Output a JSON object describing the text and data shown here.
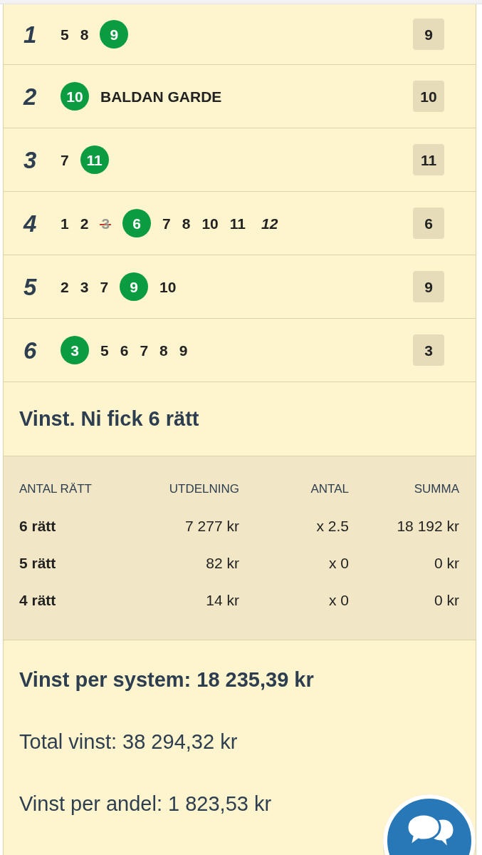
{
  "races": [
    {
      "number": "1",
      "picks": [
        {
          "text": "5",
          "kind": "plain"
        },
        {
          "text": "8",
          "kind": "plain"
        },
        {
          "text": "9",
          "kind": "winner"
        }
      ],
      "winner": "9"
    },
    {
      "number": "2",
      "picks": [
        {
          "text": "10",
          "kind": "winner"
        }
      ],
      "horse_name": "BALDAN GARDE",
      "winner": "10"
    },
    {
      "number": "3",
      "picks": [
        {
          "text": "7",
          "kind": "plain"
        },
        {
          "text": "11",
          "kind": "winner"
        }
      ],
      "winner": "11"
    },
    {
      "number": "4",
      "picks": [
        {
          "text": "1",
          "kind": "plain"
        },
        {
          "text": "2",
          "kind": "plain"
        },
        {
          "text": "3",
          "kind": "scratched"
        },
        {
          "text": "6",
          "kind": "winner"
        },
        {
          "text": "7",
          "kind": "plain"
        },
        {
          "text": "8",
          "kind": "plain"
        },
        {
          "text": "10",
          "kind": "plain"
        },
        {
          "text": "11",
          "kind": "plain"
        },
        {
          "text": "12",
          "kind": "reserve"
        }
      ],
      "winner": "6"
    },
    {
      "number": "5",
      "picks": [
        {
          "text": "2",
          "kind": "plain"
        },
        {
          "text": "3",
          "kind": "plain"
        },
        {
          "text": "7",
          "kind": "plain"
        },
        {
          "text": "9",
          "kind": "winner"
        },
        {
          "text": "10",
          "kind": "plain"
        }
      ],
      "winner": "9"
    },
    {
      "number": "6",
      "picks": [
        {
          "text": "3",
          "kind": "winner"
        },
        {
          "text": "5",
          "kind": "plain"
        },
        {
          "text": "6",
          "kind": "plain"
        },
        {
          "text": "7",
          "kind": "plain"
        },
        {
          "text": "8",
          "kind": "plain"
        },
        {
          "text": "9",
          "kind": "plain"
        }
      ],
      "winner": "3"
    }
  ],
  "result": {
    "title": "Vinst. Ni fick 6 rätt"
  },
  "payout_table": {
    "columns": [
      "ANTAL RÄTT",
      "UTDELNING",
      "ANTAL",
      "SUMMA"
    ],
    "rows": [
      [
        "6 rätt",
        "7 277 kr",
        "x 2.5",
        "18 192 kr"
      ],
      [
        "5 rätt",
        "82 kr",
        "x 0",
        "0 kr"
      ],
      [
        "4 rätt",
        "14 kr",
        "x 0",
        "0 kr"
      ]
    ]
  },
  "summary": [
    {
      "text": "Vinst per system: 18 235,39 kr",
      "bold": true
    },
    {
      "text": "Total vinst: 38 294,32 kr",
      "bold": false
    },
    {
      "text": "Vinst per andel: 1 823,53 kr",
      "bold": false
    }
  ]
}
